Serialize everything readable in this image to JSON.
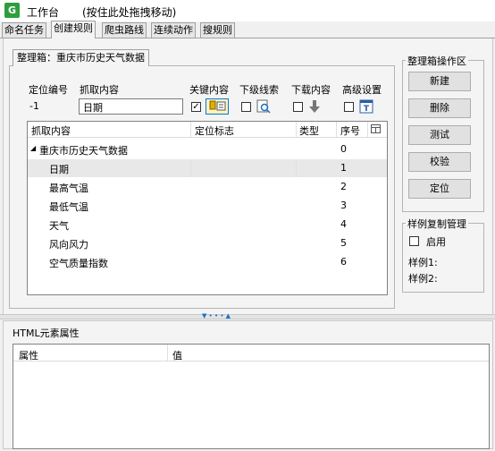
{
  "window": {
    "app_letter": "G",
    "title": "工作台",
    "hint": "(按住此处拖拽移动)"
  },
  "tabs": [
    {
      "label": "命名任务"
    },
    {
      "label": "创建规则"
    },
    {
      "label": "爬虫路线"
    },
    {
      "label": "连续动作"
    },
    {
      "label": "搜规则"
    }
  ],
  "box_tab": "整理箱：重庆市历史天气数据",
  "fields": {
    "pos_id_label": "定位编号",
    "pos_id_value": "-1",
    "grab_label": "抓取内容",
    "grab_value": "日期",
    "key_content": "关键内容",
    "sub_clue": "下级线索",
    "download": "下载内容",
    "advanced": "高级设置"
  },
  "table": {
    "columns": [
      "抓取内容",
      "定位标志",
      "类型",
      "序号"
    ],
    "root": {
      "name": "重庆市历史天气数据",
      "index": "0"
    },
    "rows": [
      {
        "name": "日期",
        "index": "1"
      },
      {
        "name": "最高气温",
        "index": "2"
      },
      {
        "name": "最低气温",
        "index": "3"
      },
      {
        "name": "天气",
        "index": "4"
      },
      {
        "name": "风向风力",
        "index": "5"
      },
      {
        "name": "空气质量指数",
        "index": "6"
      }
    ]
  },
  "ops": {
    "title": "整理箱操作区",
    "new": "新建",
    "delete": "删除",
    "test": "测试",
    "validate": "校验",
    "locate": "定位"
  },
  "sample": {
    "title": "样例复制管理",
    "enable": "启用",
    "sample1": "样例1:",
    "sample2": "样例2:"
  },
  "html_props": {
    "title": "HTML元素属性",
    "col_attr": "属性",
    "col_value": "值"
  },
  "colors": {
    "app_icon": "#2e9e3c",
    "accent": "#0078d7"
  }
}
